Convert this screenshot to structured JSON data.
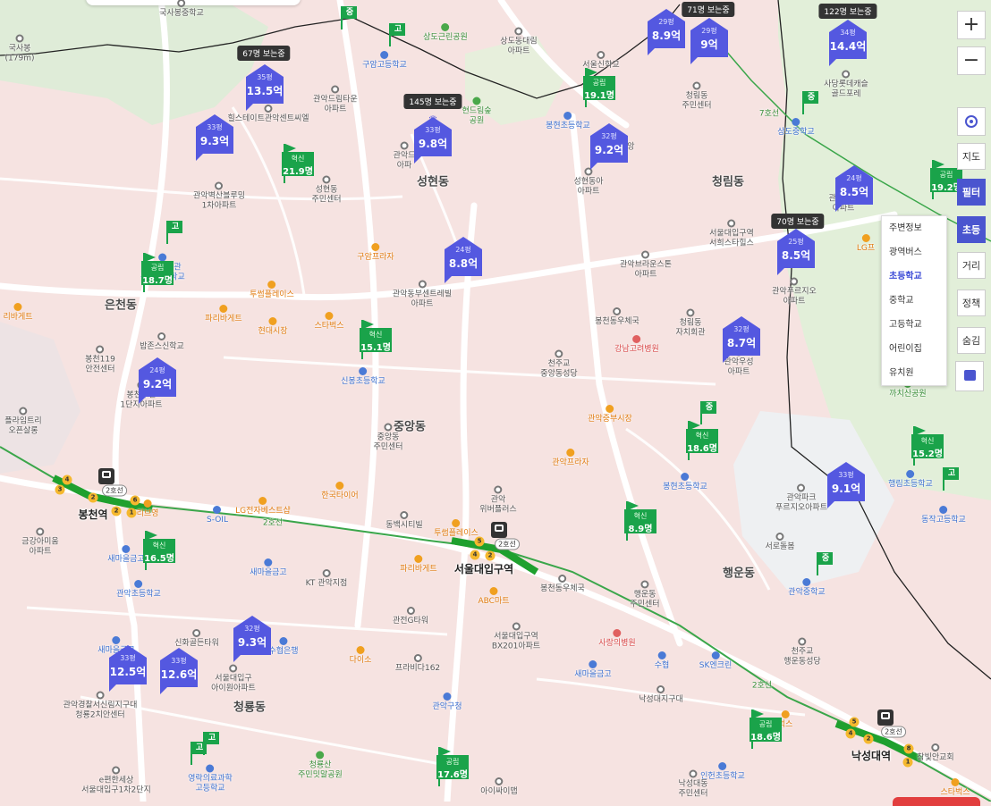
{
  "districts": [
    {
      "name": "성현동"
    },
    {
      "name": "청림동"
    },
    {
      "name": "은천동"
    },
    {
      "name": "중앙동"
    },
    {
      "name": "행운동"
    },
    {
      "name": "청룡동"
    }
  ],
  "pois": [
    {
      "name": "국사봉중학교",
      "cls": ""
    },
    {
      "name": "국사봉\n(179m)",
      "cls": ""
    },
    {
      "name": "상도근린공원",
      "cls": "green"
    },
    {
      "name": "상도동대림\n아파트",
      "cls": ""
    },
    {
      "name": "구암고등학교",
      "cls": "blue"
    },
    {
      "name": "관악드림타운\n아파트",
      "cls": ""
    },
    {
      "name": "힐스테이트관악센트씨엘",
      "cls": ""
    },
    {
      "name": "현드림숲\n공원",
      "cls": "green"
    },
    {
      "name": "서울신학교",
      "cls": ""
    },
    {
      "name": "청림동\n주민센터",
      "cls": ""
    },
    {
      "name": "봉현초등학교",
      "cls": "blue"
    },
    {
      "name": "강남중앙\n교회",
      "cls": ""
    },
    {
      "name": "사당롯데캐슬\n골드포레",
      "cls": ""
    },
    {
      "name": "상도중학교",
      "cls": "blue"
    },
    {
      "name": "관악벽산블루밍\n1차아파트",
      "cls": ""
    },
    {
      "name": "성현동\n주민센터",
      "cls": ""
    },
    {
      "name": "관악드\n아파",
      "cls": ""
    },
    {
      "name": "성현동아\n아파트",
      "cls": ""
    },
    {
      "name": "서울대입구역\n서희스타힐스",
      "cls": ""
    },
    {
      "name": "관악자이\n아파트",
      "cls": ""
    },
    {
      "name": "LG프",
      "cls": "orange"
    },
    {
      "name": "구암프라자",
      "cls": "orange"
    },
    {
      "name": "관악봉천관\n봉천초등학교",
      "cls": "blue"
    },
    {
      "name": "관악푸르지오\n아파트",
      "cls": ""
    },
    {
      "name": "관악브라운스톤\n아파트",
      "cls": ""
    },
    {
      "name": "투썸플레이스",
      "cls": "orange"
    },
    {
      "name": "관악동부센트레빌\n아파트",
      "cls": ""
    },
    {
      "name": "리바게트",
      "cls": "orange"
    },
    {
      "name": "파리바게트",
      "cls": "orange"
    },
    {
      "name": "스타벅스",
      "cls": "orange"
    },
    {
      "name": "현대시장",
      "cls": "orange"
    },
    {
      "name": "봉천동우체국",
      "cls": ""
    },
    {
      "name": "청림동\n자치회관",
      "cls": ""
    },
    {
      "name": "밥존스신학교",
      "cls": ""
    },
    {
      "name": "봉천119\n안전센터",
      "cls": ""
    },
    {
      "name": "천주교\n중앙동성당",
      "cls": ""
    },
    {
      "name": "강남고려병원",
      "cls": "red"
    },
    {
      "name": "관악우성\n아파트",
      "cls": ""
    },
    {
      "name": "신봉초등학교",
      "cls": "blue"
    },
    {
      "name": "관악중부시장",
      "cls": "orange"
    },
    {
      "name": "까치산공원",
      "cls": "green"
    },
    {
      "name": "봉천두산\n1단지아파트",
      "cls": ""
    },
    {
      "name": "플라임트리\n오픈살롱",
      "cls": ""
    },
    {
      "name": "중앙동\n주민센터",
      "cls": ""
    },
    {
      "name": "관악프라자",
      "cls": "orange"
    },
    {
      "name": "봉현초등학교",
      "cls": "blue"
    },
    {
      "name": "행림초등학교",
      "cls": "blue"
    },
    {
      "name": "동작고등학교",
      "cls": "blue"
    },
    {
      "name": "한국타이어",
      "cls": "orange"
    },
    {
      "name": "관악\n위버플러스",
      "cls": ""
    },
    {
      "name": "관악파크\n푸르지오아파트",
      "cls": ""
    },
    {
      "name": "LG전자베스트샵",
      "cls": "orange"
    },
    {
      "name": "S-OIL",
      "cls": "blue"
    },
    {
      "name": "동백시티빌",
      "cls": ""
    },
    {
      "name": "투썸플레이스",
      "cls": "orange"
    },
    {
      "name": "서로돌봄",
      "cls": ""
    },
    {
      "name": "금강아미움\n아파트",
      "cls": ""
    },
    {
      "name": "새마을금고",
      "cls": "blue"
    },
    {
      "name": "새마을금고",
      "cls": "blue"
    },
    {
      "name": "KT 관악지점",
      "cls": ""
    },
    {
      "name": "파리바게트",
      "cls": "orange"
    },
    {
      "name": "봉천동우체국",
      "cls": ""
    },
    {
      "name": "관악중학교",
      "cls": "blue"
    },
    {
      "name": "관악초등학교",
      "cls": "blue"
    },
    {
      "name": "ABC마트",
      "cls": "orange"
    },
    {
      "name": "행운동\n주민센터",
      "cls": ""
    },
    {
      "name": "관전G타워",
      "cls": ""
    },
    {
      "name": "신화골든타워",
      "cls": ""
    },
    {
      "name": "수협은행",
      "cls": "blue"
    },
    {
      "name": "서울대입구역\nBX201아파트",
      "cls": ""
    },
    {
      "name": "사랑의병원",
      "cls": "red"
    },
    {
      "name": "천주교\n행운동성당",
      "cls": ""
    },
    {
      "name": "새마을금고",
      "cls": "blue"
    },
    {
      "name": "다이소",
      "cls": "orange"
    },
    {
      "name": "서울대입구\n아이원아파트",
      "cls": ""
    },
    {
      "name": "프라비다162",
      "cls": ""
    },
    {
      "name": "수협",
      "cls": "blue"
    },
    {
      "name": "SK엔크린",
      "cls": "blue"
    },
    {
      "name": "새마을금고",
      "cls": "blue"
    },
    {
      "name": "관악경찰서신림지구대\n청룡2치안센터",
      "cls": ""
    },
    {
      "name": "낙성대지구대",
      "cls": ""
    },
    {
      "name": "관악구청",
      "cls": "blue"
    },
    {
      "name": "청룡산\n주민밋말공원",
      "cls": "green"
    },
    {
      "name": "영락의료과학\n고등학교",
      "cls": "blue"
    },
    {
      "name": "e편한세상\n서울대입구1차2단지",
      "cls": ""
    },
    {
      "name": "아이싸이맵",
      "cls": ""
    },
    {
      "name": "인헌초등학교",
      "cls": "blue"
    },
    {
      "name": "낙성대동\n주민센터",
      "cls": ""
    },
    {
      "name": "참빛안교회",
      "cls": ""
    },
    {
      "name": "스타벅스",
      "cls": "orange"
    },
    {
      "name": "벅스",
      "cls": "orange"
    },
    {
      "name": "리브영",
      "cls": "orange"
    }
  ],
  "stations": [
    {
      "name": "봉천역",
      "line_tag": "2호선"
    },
    {
      "name": "서울대입구역",
      "line_tag": "2호선"
    },
    {
      "name": "낙성대역",
      "line_tag": "2호선"
    }
  ],
  "line_labels": [
    "2호선",
    "2호선",
    "7호선"
  ],
  "apartments": [
    {
      "area": "35평",
      "price": "13.5억"
    },
    {
      "area": "33평",
      "price": "9.3억"
    },
    {
      "area": "33평",
      "price": "9.8억"
    },
    {
      "area": "29평",
      "price": "8.9억"
    },
    {
      "area": "29평",
      "price": "9억"
    },
    {
      "area": "32평",
      "price": "9.2억"
    },
    {
      "area": "34평",
      "price": "14.4억"
    },
    {
      "area": "24평",
      "price": "8.5억"
    },
    {
      "area": "25평",
      "price": "8.5억"
    },
    {
      "area": "24평",
      "price": "8.8억"
    },
    {
      "area": "32평",
      "price": "8.7억"
    },
    {
      "area": "24평",
      "price": "9.2억"
    },
    {
      "area": "33평",
      "price": "9.1억"
    },
    {
      "area": "32평",
      "price": "9.3억"
    },
    {
      "area": "33평",
      "price": "12.5억"
    },
    {
      "area": "33평",
      "price": "12.6억"
    }
  ],
  "schools": [
    {
      "type": "공립",
      "value": "19.1명"
    },
    {
      "type": "혁신",
      "value": "21.9명"
    },
    {
      "type": "공립",
      "value": "18.7명"
    },
    {
      "type": "혁신",
      "value": "15.1명"
    },
    {
      "type": "공립",
      "value": "19.2명"
    },
    {
      "type": "혁신",
      "value": "18.6명"
    },
    {
      "type": "혁신",
      "value": "15.2명"
    },
    {
      "type": "혁신",
      "value": "8.9명"
    },
    {
      "type": "혁신",
      "value": "16.5명"
    },
    {
      "type": "공립",
      "value": "18.6명"
    },
    {
      "type": "공립",
      "value": "17.6명"
    }
  ],
  "flags": [
    "중",
    "고",
    "고",
    "중",
    "중",
    "고",
    "중",
    "고",
    "고"
  ],
  "view_tags": [
    "67명 보는중",
    "71명 보는중",
    "122명 보는중",
    "145명 보는중",
    "70명 보는중"
  ],
  "controls": {
    "zoom_in": "+",
    "zoom_out": "−",
    "buttons": [
      "지도",
      "필터",
      "초등",
      "거리",
      "정책",
      "숨김"
    ],
    "active": [
      "필터",
      "초등"
    ]
  },
  "menu": {
    "items": [
      "주변정보",
      "광역버스",
      "초등학교",
      "중학교",
      "고등학교",
      "어린이집",
      "유치원"
    ],
    "selected": "초등학교"
  },
  "colors": {
    "apartment_marker": "#5458e0",
    "school_marker": "#1aa34a",
    "subway_line2": "#3aa64a",
    "district_border": "#222222",
    "map_background": "#f6e3e1"
  }
}
